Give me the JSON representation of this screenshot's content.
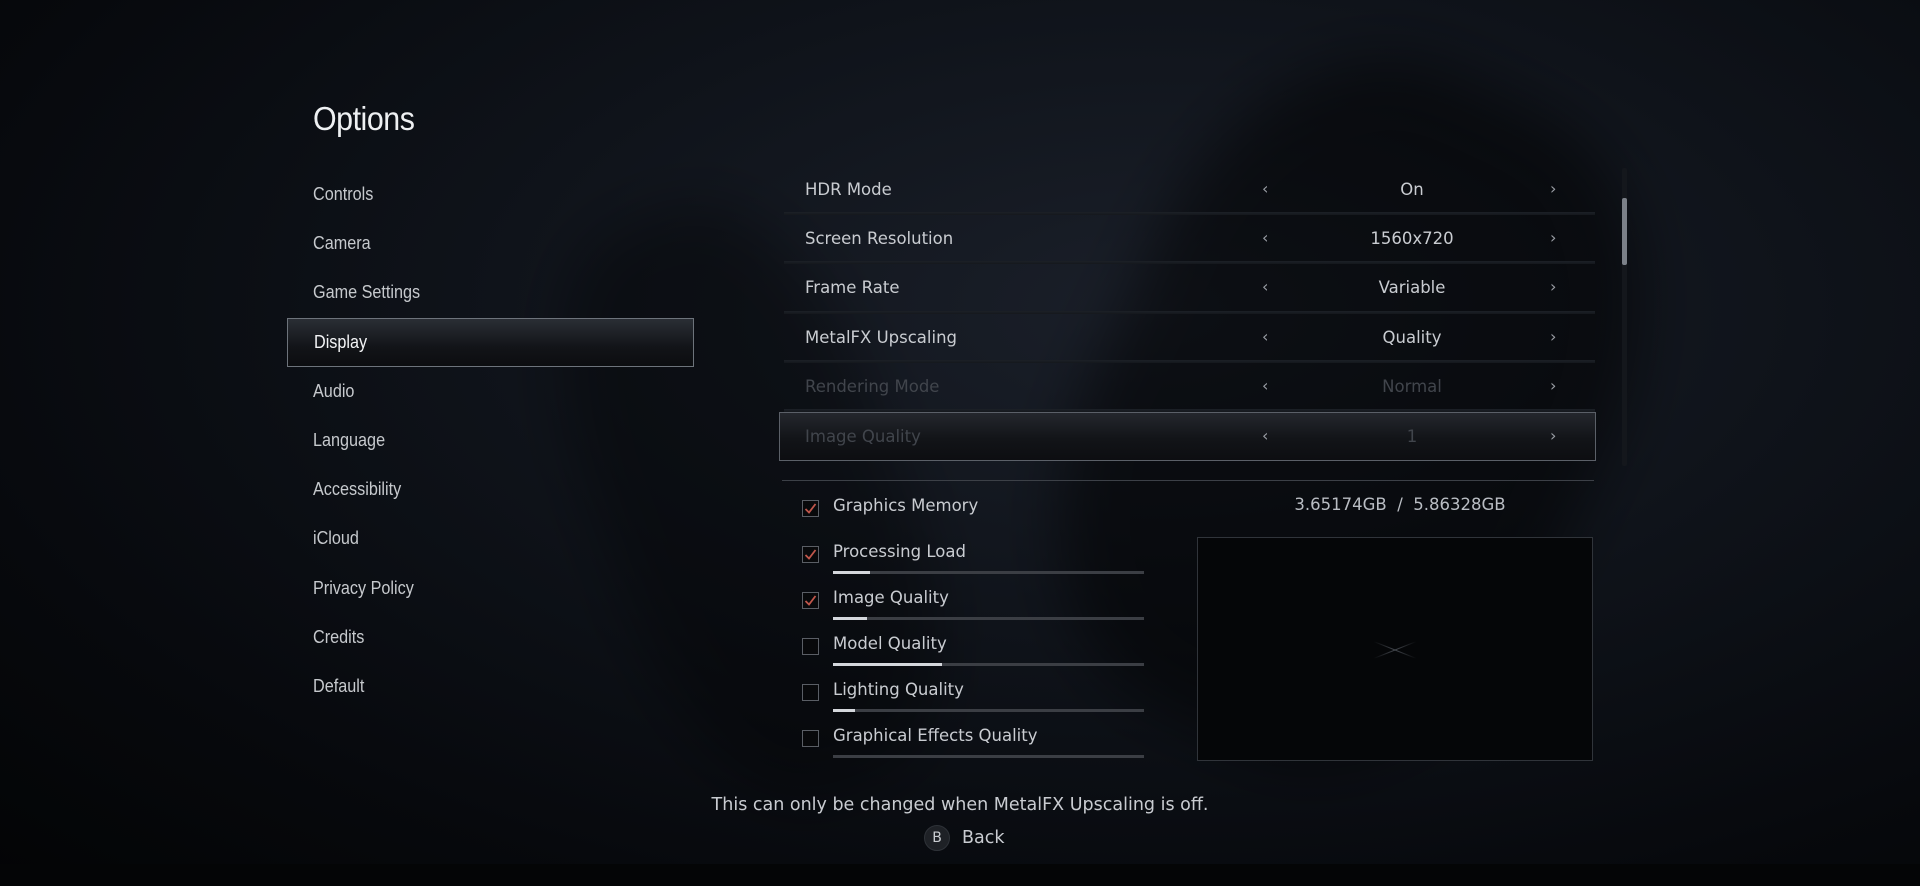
{
  "page": {
    "title": "Options"
  },
  "sidebar": {
    "items": [
      {
        "label": "Controls"
      },
      {
        "label": "Camera"
      },
      {
        "label": "Game Settings"
      },
      {
        "label": "Display",
        "active": true
      },
      {
        "label": "Audio"
      },
      {
        "label": "Language"
      },
      {
        "label": "Accessibility"
      },
      {
        "label": "iCloud"
      },
      {
        "label": "Privacy Policy"
      },
      {
        "label": "Credits"
      },
      {
        "label": "Default"
      }
    ]
  },
  "settings": {
    "rows": [
      {
        "label": "HDR Mode",
        "value": "On",
        "state": "enabled"
      },
      {
        "label": "Screen Resolution",
        "value": "1560x720",
        "state": "enabled"
      },
      {
        "label": "Frame Rate",
        "value": "Variable",
        "state": "enabled"
      },
      {
        "label": "MetalFX Upscaling",
        "value": "Quality",
        "state": "enabled"
      },
      {
        "label": "Rendering Mode",
        "value": "Normal",
        "state": "disabled"
      },
      {
        "label": "Image Quality",
        "value": "1",
        "state": "disabled-selected"
      }
    ],
    "arrow_left": "‹",
    "arrow_right": "›"
  },
  "monitor": {
    "items": [
      {
        "label": "Graphics Memory",
        "checked": true
      },
      {
        "label": "Processing Load",
        "checked": true,
        "load_percent": 12
      },
      {
        "label": "Image Quality",
        "checked": true,
        "load_percent": 11
      },
      {
        "label": "Model Quality",
        "checked": false,
        "load_percent": 35
      },
      {
        "label": "Lighting Quality",
        "checked": false,
        "load_percent": 7
      },
      {
        "label": "Graphical Effects Quality",
        "checked": false,
        "load_percent": 0
      }
    ],
    "memory_used": "3.65174GB",
    "memory_separator": "/",
    "memory_total": "5.86328GB",
    "check_color": "#c0564b"
  },
  "footer": {
    "message": "This can only be changed when MetalFX Upscaling is off.",
    "back_button_glyph": "B",
    "back_label": "Back"
  }
}
